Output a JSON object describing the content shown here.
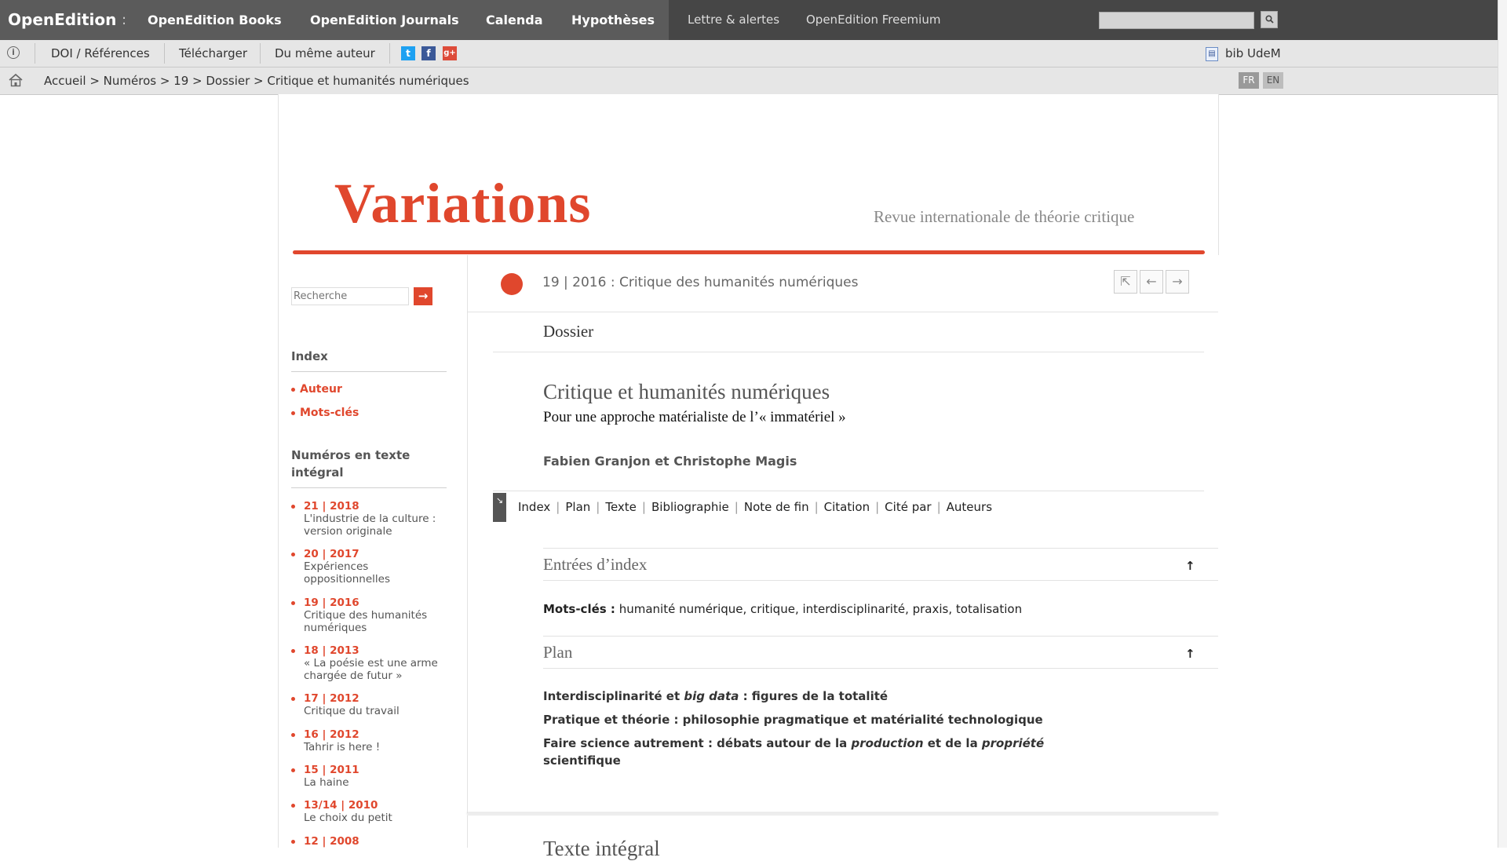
{
  "topbar": {
    "brand": "OpenEdition",
    "separator": ":",
    "nav": [
      "OpenEdition Books",
      "OpenEdition Journals",
      "Calenda",
      "Hypothèses"
    ],
    "links": [
      "Lettre & alertes",
      "OpenEdition Freemium"
    ],
    "search_placeholder": "",
    "search_icon": "magnifier-icon"
  },
  "toolbar": {
    "items": [
      "DOI / Références",
      "Télécharger",
      "Du même auteur"
    ],
    "social": [
      "t",
      "f",
      "g+"
    ],
    "institution": "bib UdeM"
  },
  "breadcrumb": {
    "text": "Accueil > Numéros > 19 > Dossier > Critique et humanités numériques",
    "lang": [
      "FR",
      "EN"
    ]
  },
  "journal": {
    "logo": "Variations",
    "tagline": "Revue internationale de théorie critique"
  },
  "sidebar": {
    "search_placeholder": "Recherche",
    "go_icon": "→",
    "index_heading": "Index",
    "index_links": [
      "Auteur",
      "Mots-clés"
    ],
    "issues_heading": "Numéros en texte intégral",
    "issues": [
      {
        "num": "21 | 2018",
        "desc": "L'industrie de la culture : version originale"
      },
      {
        "num": "20 | 2017",
        "desc": "Expériences oppositionnelles"
      },
      {
        "num": "19 | 2016",
        "desc": "Critique des humanités numériques"
      },
      {
        "num": "18 | 2013",
        "desc": "« La poésie est une arme chargée de futur »"
      },
      {
        "num": "17 | 2012",
        "desc": "Critique du travail"
      },
      {
        "num": "16 | 2012",
        "desc": "Tahrir is here !"
      },
      {
        "num": "15 | 2011",
        "desc": "La haine"
      },
      {
        "num": "13/14 | 2010",
        "desc": "Le choix du petit"
      },
      {
        "num": "12 | 2008",
        "desc": ""
      }
    ]
  },
  "article": {
    "issue": "19 | 2016 : Critique des humanités numériques",
    "nav": [
      "⇱",
      "←",
      "→"
    ],
    "section": "Dossier",
    "title": "Critique et humanités numériques",
    "subtitle": "Pour une approche matérialiste de l’« immatériel »",
    "authors": "Fabien Granjon et Christophe Magis",
    "toc_toggle": "↘",
    "toc": [
      "Index",
      "Plan",
      "Texte",
      "Bibliographie",
      "Note de fin",
      "Citation",
      "Cité par",
      "Auteurs"
    ],
    "index_heading": "Entrées d’index",
    "keywords_label": "Mots-clés :",
    "keywords": "humanité numérique, critique, interdisciplinarité, praxis, totalisation",
    "plan_heading": "Plan",
    "plan": [
      {
        "a": "Interdisciplinarité et ",
        "i": "big data",
        "b": " : figures de la totalité"
      },
      {
        "a": "Pratique et théorie : philosophie pragmatique et matérialité technologique",
        "i": "",
        "b": ""
      },
      {
        "a": "Faire science autrement : débats autour de la ",
        "i": "production",
        "b": " et de la ",
        "i2": "propriété",
        "c": " scientifique"
      }
    ],
    "arrow_up": "↑",
    "bottom_heading": "Texte intégral"
  },
  "colors": {
    "accent": "#e0472d",
    "topbar": "#5b5b5b"
  }
}
